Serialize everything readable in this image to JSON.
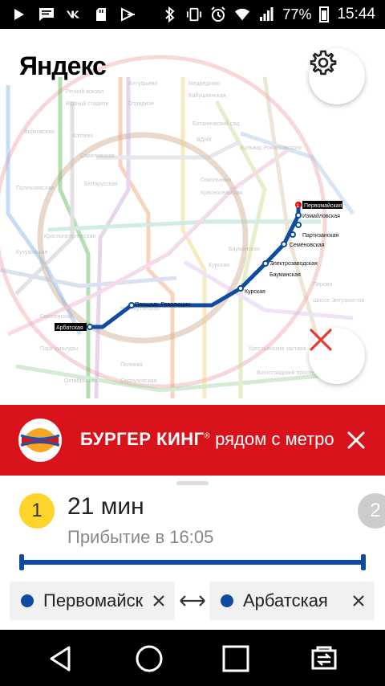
{
  "status_bar": {
    "battery_percent": "77%",
    "time": "15:44",
    "left_icons": [
      "play-store-icon",
      "message-icon",
      "vk-icon",
      "sd-card-icon",
      "media-icon"
    ],
    "right_icons": [
      "bluetooth-icon",
      "vibrate-icon",
      "alarm-icon",
      "wifi-icon",
      "signal-icon",
      "battery-icon"
    ]
  },
  "map": {
    "logo": "Яндекс",
    "route_color": "#0e4ba1",
    "stations": {
      "from_label": "Первомайская",
      "to_label": "Арбатская",
      "labels": [
        "Измайловская",
        "Партизанская",
        "Семёновская",
        "Электрозаводская",
        "Бауманская",
        "Курская",
        "Площадь Революции"
      ]
    }
  },
  "ad": {
    "logo_text": "BURGER KING",
    "brand": "БУРГЕР КИНГ",
    "reg": "®",
    "tagline": " рядом с метро",
    "bg_color": "#d8131b"
  },
  "route": {
    "index": "1",
    "next_index": "2",
    "duration": "21 мин",
    "arrival": "Прибытие в 16:05",
    "badge_color": "#fed42b"
  },
  "fields": {
    "from": "Первомайская",
    "to": "Арбатская"
  },
  "nav_bar": {
    "buttons": [
      "back-icon",
      "home-icon",
      "recents-icon",
      "screen-mirror-icon"
    ]
  }
}
